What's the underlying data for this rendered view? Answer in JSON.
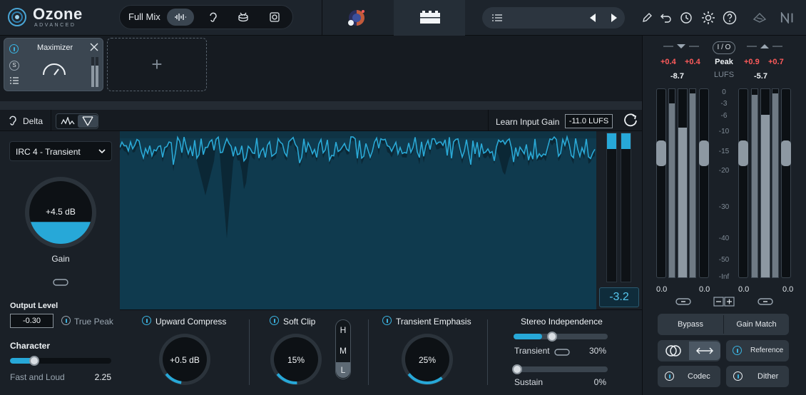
{
  "header": {
    "logo": "Ozone",
    "logo_sub": "ADVANCED",
    "mix_label": "Full Mix",
    "mix_buttons": [
      "waveform-icon",
      "ear-icon",
      "drum-icon",
      "speaker-icon"
    ],
    "icons": [
      "pencil-icon",
      "undo-icon",
      "history-icon",
      "gear-icon",
      "help-icon",
      "izotope-icon",
      "ni-icon"
    ]
  },
  "chain": {
    "module_name": "Maximizer",
    "module_side_labels": [
      "S"
    ],
    "add_symbol": "+"
  },
  "toolbar": {
    "delta_label": "Delta",
    "learn_label": "Learn Input Gain",
    "lufs_value": "-11.0 LUFS"
  },
  "left": {
    "algorithm": "IRC 4 - Transient",
    "gain_value": "+4.5 dB",
    "gain_label": "Gain",
    "gain_fill_fraction": 0.35,
    "output_label": "Output Level",
    "output_value": "-0.30",
    "true_peak_label": "True Peak",
    "character_label": "Character",
    "character_mode": "Fast and Loud",
    "character_value": "2.25",
    "character_fraction": 0.24
  },
  "display": {
    "gain_reduction": "-3.2"
  },
  "bottom": {
    "upward_title": "Upward Compress",
    "upward_value": "+0.5 dB",
    "upward_fraction": 0.12,
    "softclip_title": "Soft Clip",
    "softclip_value": "15%",
    "softclip_fraction": 0.15,
    "hml": [
      "H",
      "M",
      "L"
    ],
    "hml_selected": "L",
    "transient_title": "Transient Emphasis",
    "transient_value": "25%",
    "transient_fraction": 0.25,
    "stereo_title": "Stereo Independence",
    "transient_label": "Transient",
    "transient_pct": "30%",
    "transient_slider_fraction": 0.3,
    "sustain_label": "Sustain",
    "sustain_pct": "0%",
    "sustain_slider_fraction": 0.0
  },
  "meters": {
    "in_l_delta": "+0.4",
    "in_r_delta": "+0.4",
    "in_value": "-8.7",
    "io_label": "I / O",
    "mode_label": "Peak",
    "unit_label": "LUFS",
    "out_l_delta": "+0.9",
    "out_r_delta": "+0.7",
    "out_value": "-5.7",
    "scale": [
      "0",
      "-3",
      "-6",
      "-10",
      "-15",
      "-20",
      "-30",
      "-40",
      "-50",
      "-Inf"
    ],
    "in_gain_l": "0.0",
    "in_gain_r": "0.0",
    "out_gain_l": "0.0",
    "out_gain_r": "0.0",
    "bypass_label": "Bypass",
    "gain_match_label": "Gain Match",
    "reference_label": "Reference",
    "codec_label": "Codec",
    "dither_label": "Dither"
  },
  "colors": {
    "accent": "#27a8d8",
    "waveform_bg": "#0f3344",
    "waveform_line": "#2aa9d6",
    "clip_red": "#ff5b5b"
  }
}
